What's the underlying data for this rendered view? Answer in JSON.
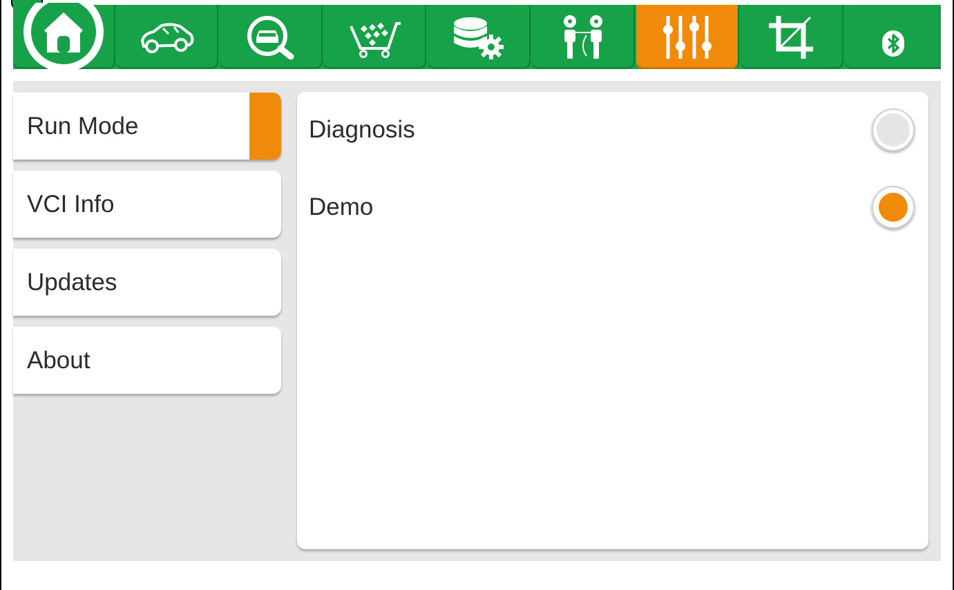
{
  "toolbar": {
    "tabs": [
      {
        "icon": "home-icon",
        "active": false
      },
      {
        "icon": "car-icon",
        "active": false
      },
      {
        "icon": "vehicle-search-icon",
        "active": false
      },
      {
        "icon": "shopping-cart-icon",
        "active": false
      },
      {
        "icon": "database-gear-icon",
        "active": false
      },
      {
        "icon": "people-connect-icon",
        "active": false
      },
      {
        "icon": "sliders-settings-icon",
        "active": true
      },
      {
        "icon": "crop-icon",
        "active": false
      },
      {
        "icon": "bluetooth-icon",
        "active": false
      }
    ],
    "colors": {
      "bar": "#17a24a",
      "active": "#ef8a0b"
    }
  },
  "sidebar": {
    "items": [
      {
        "label": "Run Mode",
        "selected": true
      },
      {
        "label": "VCI Info",
        "selected": false
      },
      {
        "label": "Updates",
        "selected": false
      },
      {
        "label": "About",
        "selected": false
      }
    ]
  },
  "run_mode": {
    "options": [
      {
        "label": "Diagnosis",
        "checked": false
      },
      {
        "label": "Demo",
        "checked": true
      }
    ]
  }
}
